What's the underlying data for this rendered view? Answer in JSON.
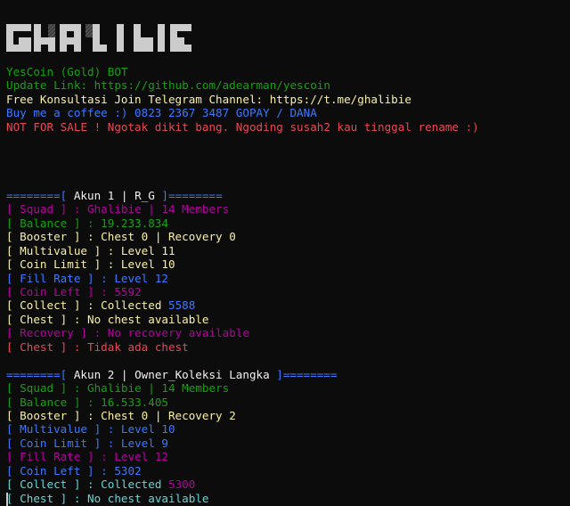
{
  "logo": {
    "text": "GHALIBIE"
  },
  "header": {
    "title": "YesCoin (Gold) BOT",
    "update_link": "Update Link: https://github.com/adearman/yescoin",
    "telegram": "Free Konsultasi Join Telegram Channel: https://t.me/ghalibie",
    "coffee": "Buy me a coffee :) 0823 2367 3487 GOPAY / DANA",
    "warning": "NOT FOR SALE ! Ngotak dikit bang. Ngoding susah2 kau tinggal rename :)"
  },
  "accounts": [
    {
      "sep_left": "========[",
      "title": " Akun 1 | R_G ",
      "sep_right": "]========",
      "squad": {
        "label": "[ Squad ] : ",
        "value": "Ghalibie | 14 Members"
      },
      "balance": {
        "label": "[ Balance ] : ",
        "value": "19.233.834"
      },
      "booster": {
        "label": "[ Booster ] : ",
        "value": "Chest 0 | Recovery 0"
      },
      "multivalue": {
        "label": "[ Multivalue ] : ",
        "value": "Level 11"
      },
      "coin_limit": {
        "label": "[ Coin Limit ] : ",
        "value": "Level 10"
      },
      "fill_rate": {
        "label": "[ Fill Rate ] : ",
        "value": "Level 12"
      },
      "coin_left": {
        "label": "[ Coin Left ] : ",
        "value": "5592"
      },
      "collect": {
        "label": "[ Collect ] : ",
        "value": "Collected ",
        "amount": "5588"
      },
      "chest": {
        "label": "[ Chest ] : ",
        "value": "No chest available"
      },
      "recovery": {
        "label": "[ Recovery ] : ",
        "value": "No recovery available"
      },
      "chest2": {
        "label": "[ Chest ] : ",
        "value": "Tidak ada chest"
      }
    },
    {
      "sep_left": "========[",
      "title": " Akun 2 | Owner_Koleksi Langka ",
      "sep_right": "]========",
      "squad": {
        "label": "[ Squad ] : ",
        "value": "Ghalibie | 14 Members"
      },
      "balance": {
        "label": "[ Balance ] : ",
        "value": "16.533.405"
      },
      "booster": {
        "label": "[ Booster ] : ",
        "value": "Chest 0 | Recovery 2"
      },
      "multivalue": {
        "label": "[ Multivalue ] : ",
        "value": "Level 10"
      },
      "coin_limit": {
        "label": "[ Coin Limit ] : ",
        "value": "Level 9"
      },
      "fill_rate": {
        "label": "[ Fill Rate ] : ",
        "value": "Level 12"
      },
      "coin_left": {
        "label": "[ Coin Left ] : ",
        "value": "5302"
      },
      "collect": {
        "label": "[ Collect ] : ",
        "value": "Collected ",
        "amount": "5300"
      },
      "chest": {
        "label": "[ Chest ] : ",
        "value": "No chest available"
      }
    }
  ],
  "colors": {
    "background": "#0c0c0c",
    "green": "#16c60c",
    "yellow": "#f9f1a5",
    "blue": "#3b78ff",
    "magenta": "#b4009e",
    "red": "#e74856",
    "cyan": "#61d6d6"
  }
}
